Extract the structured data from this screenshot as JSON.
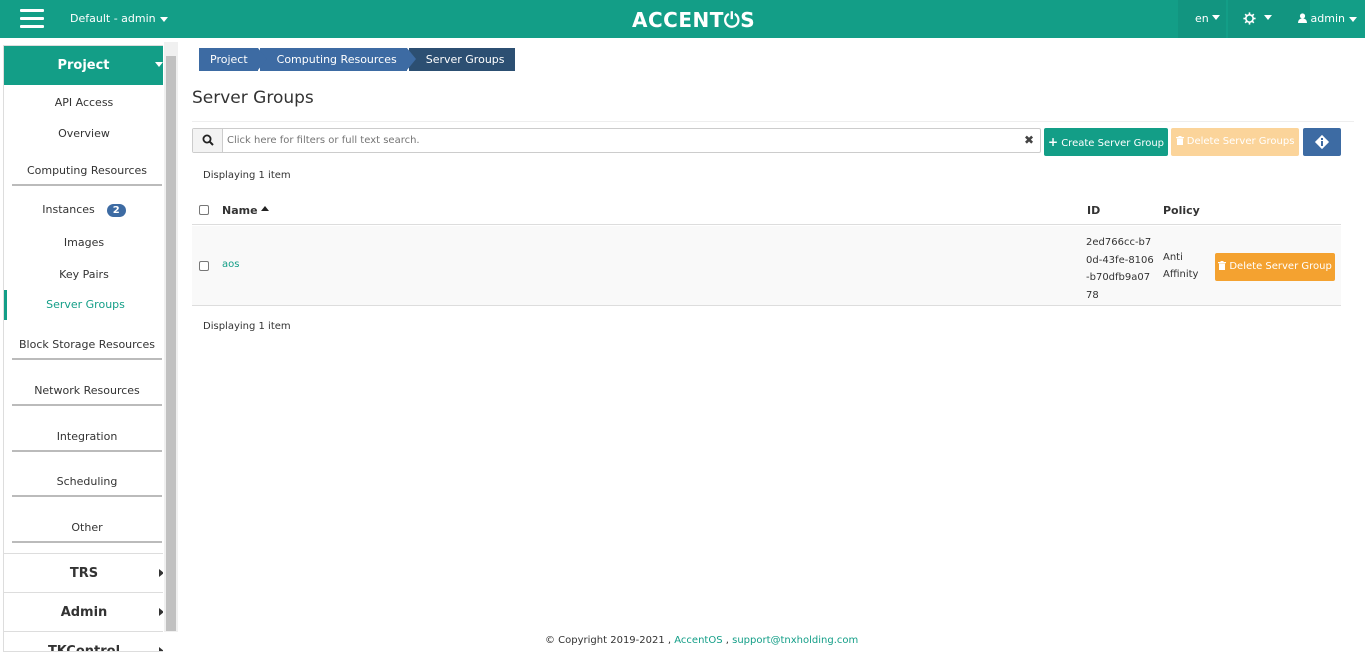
{
  "topbar": {
    "project_select": "Default - admin",
    "logo": "ACCENT⏻S",
    "lang": "en",
    "user": "admin"
  },
  "sidebar": {
    "project_header": "Project",
    "api_access": "API Access",
    "overview": "Overview",
    "computing_resources": "Computing Resources",
    "instances": "Instances",
    "instances_badge": "2",
    "images": "Images",
    "key_pairs": "Key Pairs",
    "server_groups": "Server Groups",
    "block_storage": "Block Storage Resources",
    "network": "Network Resources",
    "integration": "Integration",
    "scheduling": "Scheduling",
    "other": "Other",
    "trs": "TRS",
    "admin": "Admin",
    "tkcontrol": "TKControl"
  },
  "breadcrumb": [
    "Project",
    "Computing Resources",
    "Server Groups"
  ],
  "page_title": "Server Groups",
  "search": {
    "placeholder": "Click here for filters or full text search."
  },
  "actions": {
    "create": "Create Server Group",
    "delete_multi": "Delete Server Groups"
  },
  "table": {
    "count_top": "Displaying 1 item",
    "count_bottom": "Displaying 1 item",
    "headers": {
      "name": "Name",
      "id": "ID",
      "policy": "Policy"
    },
    "rows": [
      {
        "name": "aos",
        "id": "2ed766cc-b70d-43fe-8106-b70dfb9a0778",
        "policy": "Anti Affinity",
        "action": "Delete Server Group"
      }
    ]
  },
  "footer": {
    "copyright": "© Copyright 2019-2021 , ",
    "brand": "AccentOS",
    "sep": " , ",
    "email": "support@tnxholding.com"
  },
  "colors": {
    "brand": "#139e87",
    "crumb": "#3d6ba3",
    "crumb_active": "#2c4f72",
    "warning": "#f4a230"
  }
}
